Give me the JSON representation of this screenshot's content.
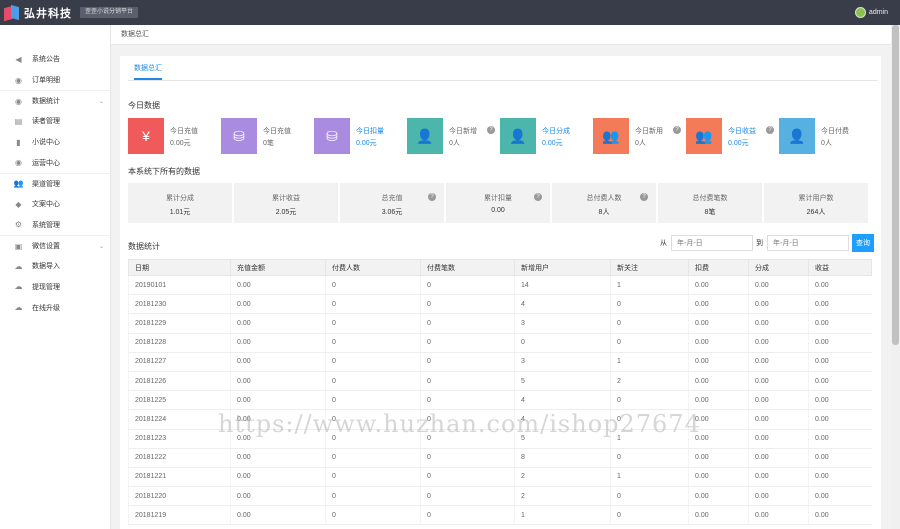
{
  "header": {
    "brand": "弘井科技",
    "subtitle": "歪歪小说分销平台",
    "user": "admin"
  },
  "sidebar": {
    "items": [
      {
        "label": "系统公告",
        "icon": "speaker-icon",
        "group": false,
        "chevron": false
      },
      {
        "label": "订单明细",
        "icon": "circle-icon",
        "group": false,
        "chevron": false
      },
      {
        "label": "数据统计",
        "icon": "circle-icon",
        "group": true,
        "chevron": true
      },
      {
        "label": "读者管理",
        "icon": "list-icon",
        "group": false,
        "chevron": false
      },
      {
        "label": "小说中心",
        "icon": "book-icon",
        "group": false,
        "chevron": false
      },
      {
        "label": "运营中心",
        "icon": "circle-icon",
        "group": false,
        "chevron": false
      },
      {
        "label": "渠道管理",
        "icon": "users-icon",
        "group": true,
        "chevron": false
      },
      {
        "label": "文案中心",
        "icon": "pin-icon",
        "group": false,
        "chevron": false
      },
      {
        "label": "系统管理",
        "icon": "gear-icon",
        "group": false,
        "chevron": false
      },
      {
        "label": "微信设置",
        "icon": "briefcase-icon",
        "group": true,
        "chevron": true
      },
      {
        "label": "数据导入",
        "icon": "cloud-icon",
        "group": false,
        "chevron": false
      },
      {
        "label": "提现管理",
        "icon": "cloud-icon",
        "group": false,
        "chevron": false
      },
      {
        "label": "在线升级",
        "icon": "cloud-icon",
        "group": false,
        "chevron": false
      }
    ]
  },
  "breadcrumb": "数据总汇",
  "tab": "数据总汇",
  "today_title": "今日数据",
  "today_cards": [
    {
      "label": "今日充值",
      "value": "0.00元",
      "color": "#f05a5a",
      "icon": "yen-icon",
      "glyph": "¥",
      "active": false,
      "question": false
    },
    {
      "label": "今日充值",
      "value": "0笔",
      "color": "#a98ce0",
      "icon": "coins-icon",
      "glyph": "⛁",
      "active": false,
      "question": false
    },
    {
      "label": "今日扣量",
      "value": "0.00元",
      "color": "#a98ce0",
      "icon": "coins-icon",
      "glyph": "⛁",
      "active": true,
      "question": false
    },
    {
      "label": "今日新增",
      "value": "0人",
      "color": "#4db6ac",
      "icon": "user-add-icon",
      "glyph": "👤",
      "active": false,
      "question": true
    },
    {
      "label": "今日分成",
      "value": "0.00元",
      "color": "#4db6ac",
      "icon": "user-add-icon",
      "glyph": "👤",
      "active": true,
      "question": false
    },
    {
      "label": "今日新用",
      "value": "0人",
      "color": "#f37b5a",
      "icon": "users-icon",
      "glyph": "👥",
      "active": false,
      "question": true
    },
    {
      "label": "今日收益",
      "value": "0.00元",
      "color": "#f37b5a",
      "icon": "users-icon",
      "glyph": "👥",
      "active": true,
      "question": true
    },
    {
      "label": "今日付费",
      "value": "0人",
      "color": "#56b0e0",
      "icon": "user-icon",
      "glyph": "👤",
      "active": false,
      "question": false
    }
  ],
  "all_title": "本系统下所有的数据",
  "stats": [
    {
      "label": "累计分成",
      "value": "1.01元",
      "question": false
    },
    {
      "label": "累计收益",
      "value": "2.05元",
      "question": false
    },
    {
      "label": "总充值",
      "value": "3.06元",
      "question": true
    },
    {
      "label": "累计扣量",
      "value": "0.00",
      "question": true
    },
    {
      "label": "总付费人数",
      "value": "8人",
      "question": true
    },
    {
      "label": "总付费笔数",
      "value": "8笔",
      "question": false
    },
    {
      "label": "累计用户数",
      "value": "264人",
      "question": false
    }
  ],
  "daily_title": "数据统计",
  "filter": {
    "from_label": "从",
    "to_label": "到",
    "placeholder": "年-月-日",
    "search_label": "查询"
  },
  "table": {
    "headers": [
      "日期",
      "充值金额",
      "付费人数",
      "付费笔数",
      "新增用户",
      "新关注",
      "扣费",
      "分成",
      "收益"
    ],
    "rows": [
      [
        "20190101",
        "0.00",
        "0",
        "0",
        "14",
        "1",
        "0.00",
        "0.00",
        "0.00"
      ],
      [
        "20181230",
        "0.00",
        "0",
        "0",
        "4",
        "0",
        "0.00",
        "0.00",
        "0.00"
      ],
      [
        "20181229",
        "0.00",
        "0",
        "0",
        "3",
        "0",
        "0.00",
        "0.00",
        "0.00"
      ],
      [
        "20181228",
        "0.00",
        "0",
        "0",
        "0",
        "0",
        "0.00",
        "0.00",
        "0.00"
      ],
      [
        "20181227",
        "0.00",
        "0",
        "0",
        "3",
        "1",
        "0.00",
        "0.00",
        "0.00"
      ],
      [
        "20181226",
        "0.00",
        "0",
        "0",
        "5",
        "2",
        "0.00",
        "0.00",
        "0.00"
      ],
      [
        "20181225",
        "0.00",
        "0",
        "0",
        "4",
        "0",
        "0.00",
        "0.00",
        "0.00"
      ],
      [
        "20181224",
        "0.00",
        "0",
        "0",
        "4",
        "0",
        "0.00",
        "0.00",
        "0.00"
      ],
      [
        "20181223",
        "0.00",
        "0",
        "0",
        "5",
        "1",
        "0.00",
        "0.00",
        "0.00"
      ],
      [
        "20181222",
        "0.00",
        "0",
        "0",
        "8",
        "0",
        "0.00",
        "0.00",
        "0.00"
      ],
      [
        "20181221",
        "0.00",
        "0",
        "0",
        "2",
        "1",
        "0.00",
        "0.00",
        "0.00"
      ],
      [
        "20181220",
        "0.00",
        "0",
        "0",
        "2",
        "0",
        "0.00",
        "0.00",
        "0.00"
      ],
      [
        "20181219",
        "0.00",
        "0",
        "0",
        "1",
        "0",
        "0.00",
        "0.00",
        "0.00"
      ]
    ]
  },
  "watermark": "https://www.huzhan.com/ishop27674"
}
